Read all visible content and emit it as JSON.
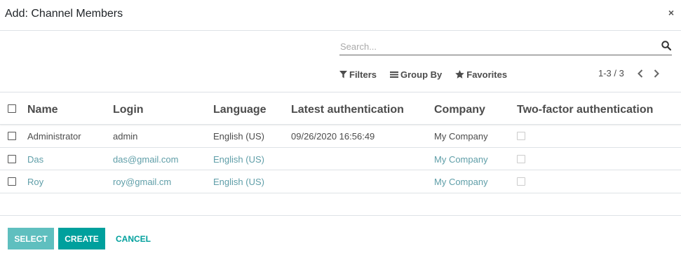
{
  "dialog": {
    "title": "Add: Channel Members",
    "close_label": "×"
  },
  "search": {
    "placeholder": "Search..."
  },
  "filters": {
    "filters_label": "Filters",
    "group_by_label": "Group By",
    "favorites_label": "Favorites"
  },
  "pager": {
    "text": "1-3 / 3"
  },
  "table": {
    "headers": {
      "name": "Name",
      "login": "Login",
      "language": "Language",
      "latest_auth": "Latest authentication",
      "company": "Company",
      "two_factor": "Two-factor authentication"
    },
    "rows": [
      {
        "name": "Administrator",
        "login": "admin",
        "language": "English (US)",
        "latest_auth": "09/26/2020 16:56:49",
        "company": "My Company"
      },
      {
        "name": "Das",
        "login": "das@gmail.com",
        "language": "English (US)",
        "latest_auth": "",
        "company": "My Company"
      },
      {
        "name": "Roy",
        "login": "roy@gmail.cm",
        "language": "English (US)",
        "latest_auth": "",
        "company": "My Company"
      }
    ]
  },
  "footer": {
    "select_label": "SELECT",
    "create_label": "CREATE",
    "cancel_label": "CANCEL"
  },
  "colors": {
    "primary": "#00a09d",
    "primary_disabled": "#5fbfbf",
    "link": "#5f9ea8"
  }
}
